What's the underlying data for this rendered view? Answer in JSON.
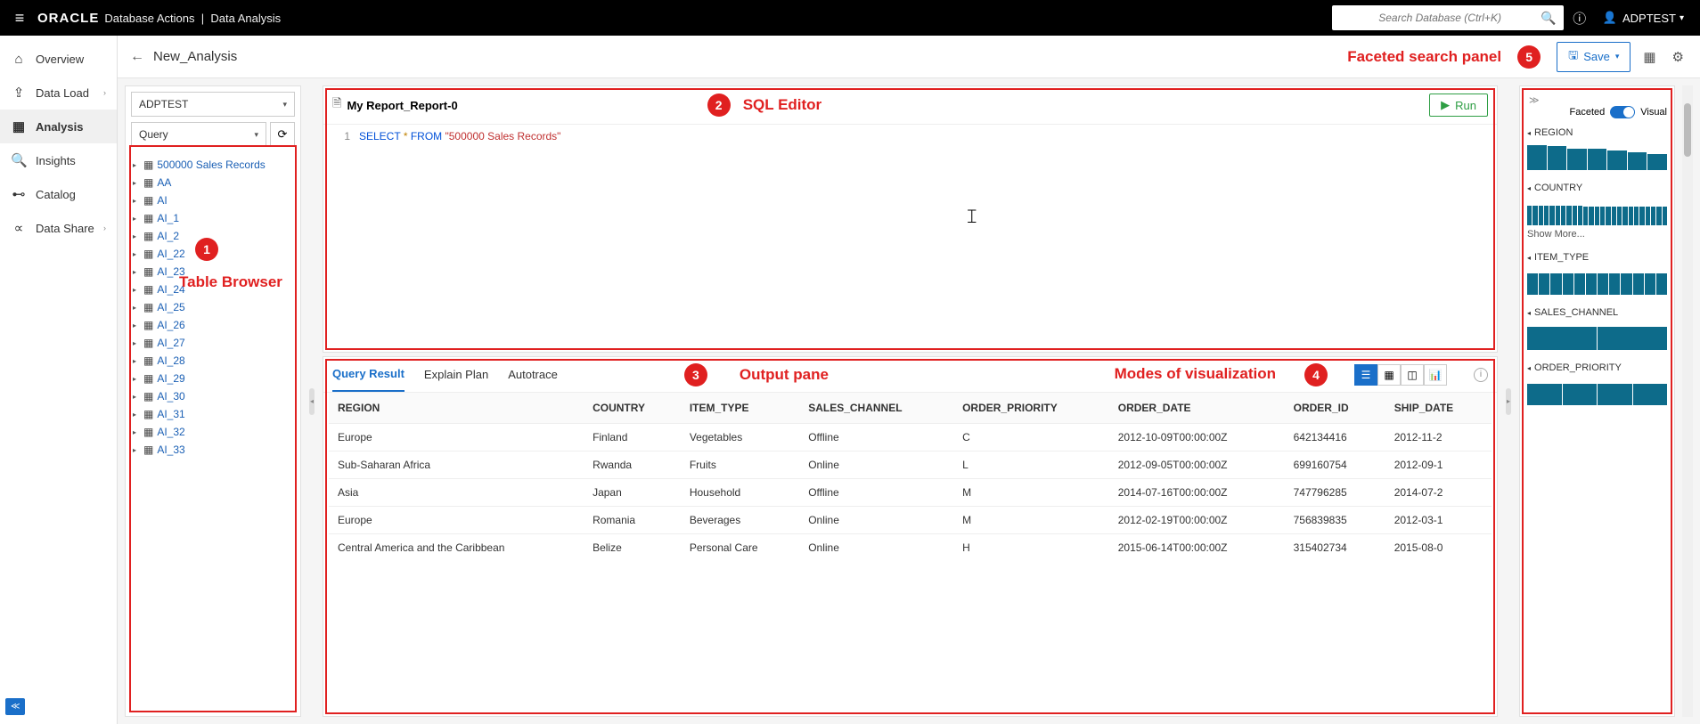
{
  "app": {
    "brand": "ORACLE",
    "section": "Database Actions",
    "page": "Data Analysis",
    "search_placeholder": "Search Database (Ctrl+K)",
    "user": "ADPTEST"
  },
  "nav": {
    "items": [
      {
        "label": "Overview",
        "icon": "⌂"
      },
      {
        "label": "Data Load",
        "icon": "⇪",
        "chev": true
      },
      {
        "label": "Analysis",
        "icon": "▦",
        "active": true
      },
      {
        "label": "Insights",
        "icon": "🔍"
      },
      {
        "label": "Catalog",
        "icon": "⊷"
      },
      {
        "label": "Data Share",
        "icon": "∝",
        "chev": true
      }
    ]
  },
  "crumb": {
    "title": "New_Analysis",
    "save": "Save"
  },
  "browser": {
    "schema": "ADPTEST",
    "filter": "Query",
    "tables": [
      "500000 Sales Records",
      "AA",
      "AI",
      "AI_1",
      "AI_2",
      "AI_22",
      "AI_23",
      "AI_24",
      "AI_25",
      "AI_26",
      "AI_27",
      "AI_28",
      "AI_29",
      "AI_30",
      "AI_31",
      "AI_32",
      "AI_33"
    ]
  },
  "editor": {
    "title": "My Report_Report-0",
    "run": "Run",
    "line": "1",
    "sql_select": "SELECT",
    "sql_star": "*",
    "sql_from": "FROM",
    "sql_str": "\"500000 Sales Records\""
  },
  "output": {
    "tabs": [
      "Query Result",
      "Explain Plan",
      "Autotrace"
    ],
    "columns": [
      "REGION",
      "COUNTRY",
      "ITEM_TYPE",
      "SALES_CHANNEL",
      "ORDER_PRIORITY",
      "ORDER_DATE",
      "ORDER_ID",
      "SHIP_DATE"
    ],
    "rows": [
      [
        "Europe",
        "Finland",
        "Vegetables",
        "Offline",
        "C",
        "2012-10-09T00:00:00Z",
        "642134416",
        "2012-11-2"
      ],
      [
        "Sub-Saharan Africa",
        "Rwanda",
        "Fruits",
        "Online",
        "L",
        "2012-09-05T00:00:00Z",
        "699160754",
        "2012-09-1"
      ],
      [
        "Asia",
        "Japan",
        "Household",
        "Offline",
        "M",
        "2014-07-16T00:00:00Z",
        "747796285",
        "2014-07-2"
      ],
      [
        "Europe",
        "Romania",
        "Beverages",
        "Online",
        "M",
        "2012-02-19T00:00:00Z",
        "756839835",
        "2012-03-1"
      ],
      [
        "Central America and the Caribbean",
        "Belize",
        "Personal Care",
        "Online",
        "H",
        "2015-06-14T00:00:00Z",
        "315402734",
        "2015-08-0"
      ]
    ]
  },
  "faceted": {
    "left_label": "Faceted",
    "right_label": "Visual",
    "show_more": "Show More...",
    "sections": [
      {
        "name": "REGION",
        "bars": [
          28,
          27,
          24,
          24,
          22,
          20,
          18
        ]
      },
      {
        "name": "COUNTRY",
        "bars": [
          22,
          22,
          22,
          22,
          22,
          22,
          22,
          22,
          22,
          22,
          21,
          21,
          21,
          21,
          21,
          21,
          21,
          21,
          21,
          21,
          21,
          21,
          21,
          21,
          21
        ],
        "more": true
      },
      {
        "name": "ITEM_TYPE",
        "bars": [
          24,
          24,
          24,
          24,
          24,
          24,
          24,
          24,
          24,
          24,
          24,
          24
        ]
      },
      {
        "name": "SALES_CHANNEL",
        "bars": [
          26,
          26
        ]
      },
      {
        "name": "ORDER_PRIORITY",
        "bars": [
          24,
          24,
          24,
          24
        ]
      }
    ]
  },
  "annotations": {
    "a1": "Table Browser",
    "a2": "SQL Editor",
    "a3": "Output pane",
    "a4": "Modes of visualization",
    "a5": "Faceted search panel"
  }
}
